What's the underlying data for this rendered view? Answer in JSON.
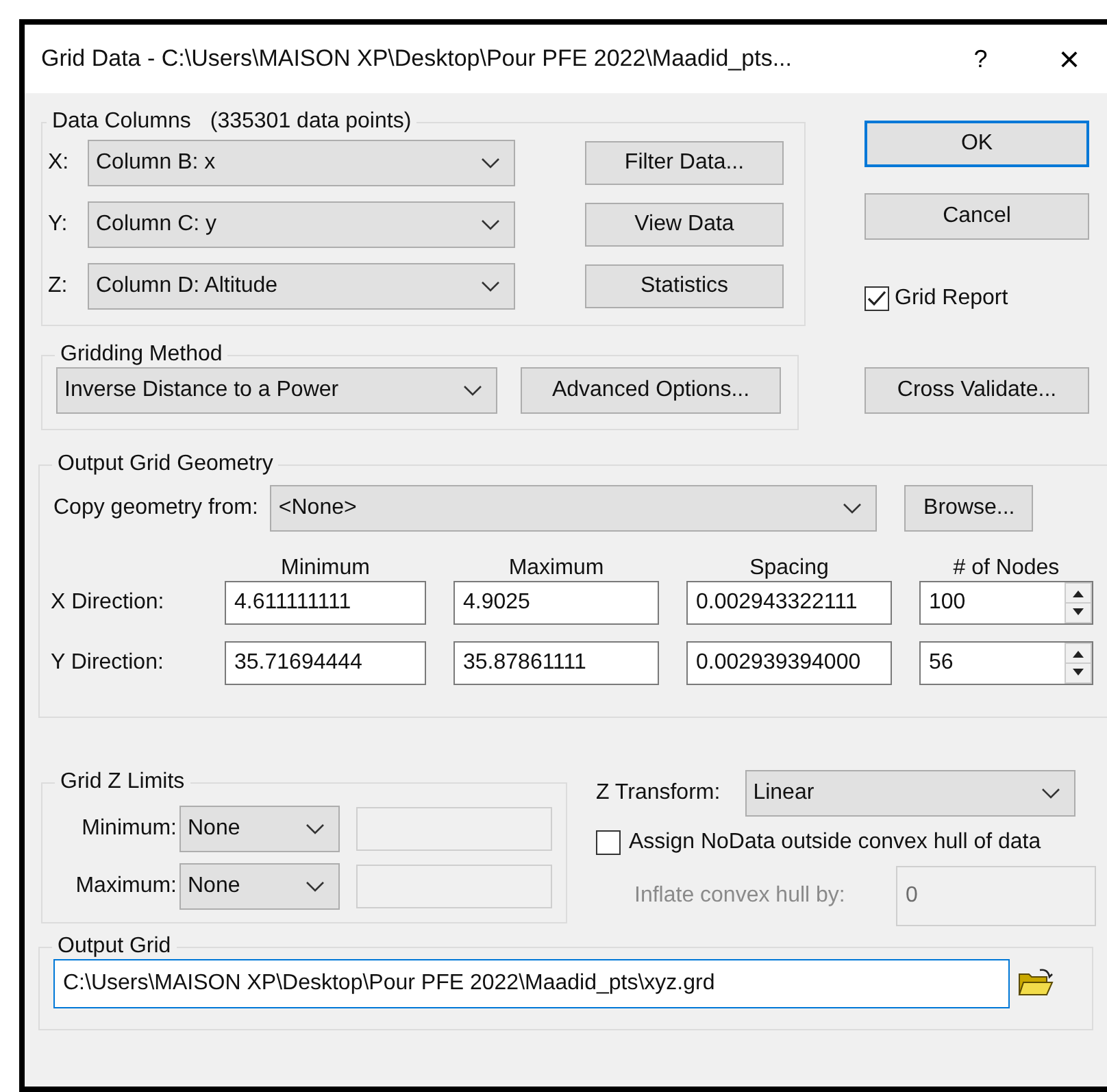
{
  "window": {
    "title": "Grid Data - C:\\Users\\MAISON XP\\Desktop\\Pour PFE 2022\\Maadid_pts...",
    "help_button": "?",
    "close_button": "×"
  },
  "data_columns": {
    "label": "Data Columns",
    "count": "(335301 data points)",
    "rows": [
      {
        "axis": "X:",
        "value": "Column B:  x"
      },
      {
        "axis": "Y:",
        "value": "Column C:  y"
      },
      {
        "axis": "Z:",
        "value": "Column D:  Altitude"
      }
    ],
    "buttons": [
      "Filter Data...",
      "View Data",
      "Statistics"
    ]
  },
  "dialog_buttons": [
    {
      "label": "OK",
      "default": true
    },
    {
      "label": "Cancel",
      "default": false
    }
  ],
  "grid_report": {
    "label": "Grid Report",
    "checked": true
  },
  "gridding_method": {
    "label": "Gridding Method",
    "value": "Inverse Distance to a Power",
    "button": "Advanced Options..."
  },
  "cross_validate": "Cross Validate...",
  "geometry": {
    "label": "Output Grid Geometry",
    "copy_label": "Copy geometry from:",
    "copy_value": "<None>",
    "browse": "Browse...",
    "columns": [
      "Minimum",
      "Maximum",
      "Spacing",
      "# of Nodes"
    ],
    "rows": [
      {
        "label": "X Direction:",
        "values": [
          "4.611111111",
          "4.9025",
          "0.002943322111",
          "100"
        ]
      },
      {
        "label": "Y Direction:",
        "values": [
          "35.71694444",
          "35.87861111",
          "0.002939394000",
          "56"
        ]
      }
    ]
  },
  "z_limits": {
    "label": "Grid Z Limits",
    "rows": [
      {
        "label": "Minimum:",
        "value": "None"
      },
      {
        "label": "Maximum:",
        "value": "None"
      }
    ]
  },
  "z_transform": {
    "label": "Z Transform:",
    "value": "Linear"
  },
  "assign_nodata": {
    "label": "Assign NoData outside convex hull of data",
    "checked": false
  },
  "inflate": {
    "label": "Inflate convex hull by:",
    "value": "0",
    "disabled": true
  },
  "output_grid": {
    "label": "Output Grid",
    "value": "C:\\Users\\MAISON XP\\Desktop\\Pour PFE 2022\\Maadid_pts\\xyz.grd",
    "focused": true
  }
}
